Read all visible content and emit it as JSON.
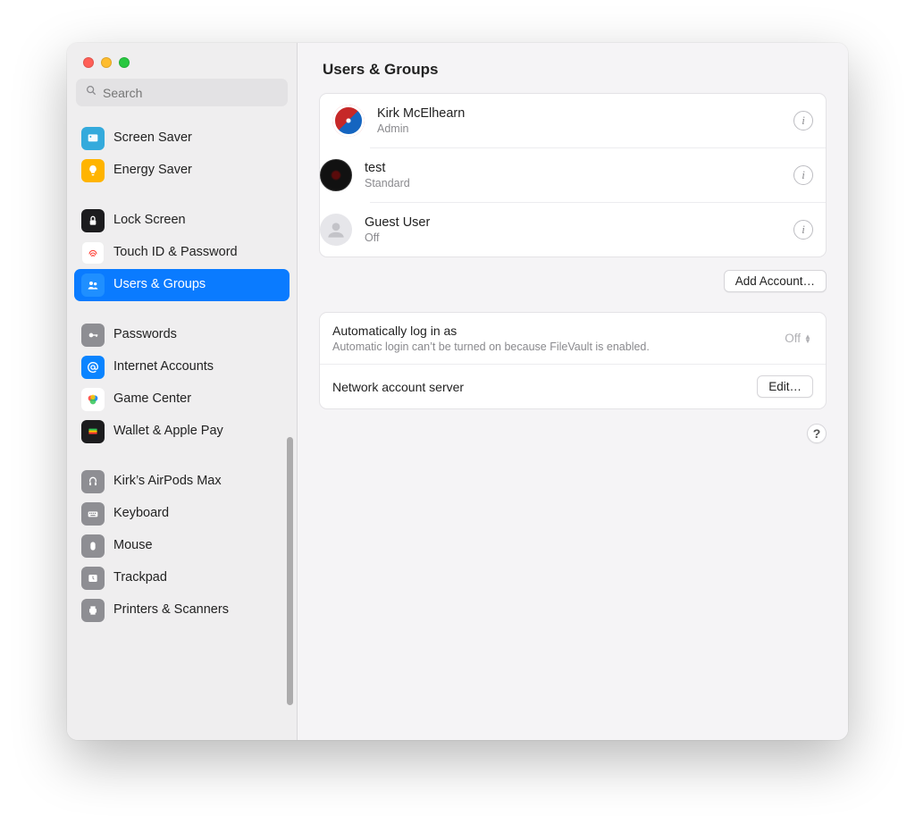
{
  "search": {
    "placeholder": "Search"
  },
  "sidebar": {
    "groups": [
      {
        "items": [
          {
            "label": "Screen Saver"
          },
          {
            "label": "Energy Saver"
          }
        ]
      },
      {
        "items": [
          {
            "label": "Lock Screen"
          },
          {
            "label": "Touch ID & Password"
          },
          {
            "label": "Users & Groups"
          }
        ]
      },
      {
        "items": [
          {
            "label": "Passwords"
          },
          {
            "label": "Internet Accounts"
          },
          {
            "label": "Game Center"
          },
          {
            "label": "Wallet & Apple Pay"
          }
        ]
      },
      {
        "items": [
          {
            "label": "Kirk’s AirPods Max"
          },
          {
            "label": "Keyboard"
          },
          {
            "label": "Mouse"
          },
          {
            "label": "Trackpad"
          },
          {
            "label": "Printers & Scanners"
          }
        ]
      }
    ]
  },
  "page": {
    "title": "Users & Groups"
  },
  "users": [
    {
      "name": "Kirk McElhearn",
      "role": "Admin"
    },
    {
      "name": "test",
      "role": "Standard"
    },
    {
      "name": "Guest User",
      "role": "Off"
    }
  ],
  "buttons": {
    "add_account": "Add Account…",
    "edit": "Edit…"
  },
  "auto_login": {
    "label": "Automatically log in as",
    "value": "Off",
    "note": "Automatic login can’t be turned on because FileVault is enabled."
  },
  "network_server": {
    "label": "Network account server"
  },
  "help": "?"
}
